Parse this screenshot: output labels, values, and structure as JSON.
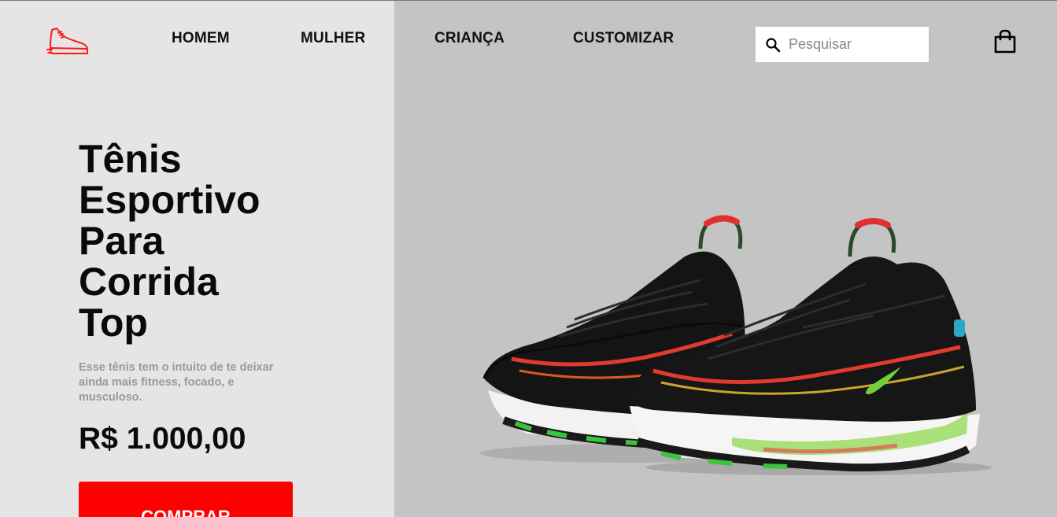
{
  "nav": {
    "links": [
      "HOMEM",
      "MULHER",
      "CRIANÇA",
      "CUSTOMIZAR"
    ]
  },
  "search": {
    "placeholder": "Pesquisar"
  },
  "product": {
    "title_lines": [
      "Tênis",
      "Esportivo",
      "Para",
      "Corrida",
      "Top"
    ],
    "description": "Esse tênis tem o intuito de te deixar ainda mais fitness, focado, e musculoso.",
    "price": "R$ 1.000,00",
    "buy_label": "COMPRAR"
  },
  "colors": {
    "accent": "#ff0000",
    "left_bg": "#e5e5e5",
    "right_bg": "#c4c4c4"
  },
  "icons": {
    "logo": "running-shoe-icon",
    "search": "search-icon",
    "cart": "shopping-bag-icon"
  }
}
